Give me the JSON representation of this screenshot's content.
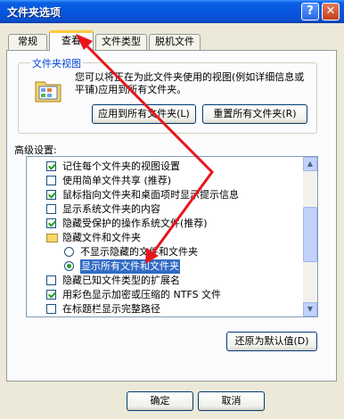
{
  "title": "文件夹选项",
  "title_buttons": {
    "help": "?",
    "close": "✕"
  },
  "tabs": [
    {
      "label": "常规"
    },
    {
      "label": "查看"
    },
    {
      "label": "文件类型"
    },
    {
      "label": "脱机文件"
    }
  ],
  "folder_views": {
    "label": "文件夹视图",
    "description": "您可以将正在为此文件夹使用的视图(例如详细信息或平铺)应用到所有文件夹。",
    "apply_all_button": "应用到所有文件夹(L)",
    "reset_all_button": "重置所有文件夹(R)"
  },
  "advanced": {
    "label": "高级设置:",
    "items": [
      {
        "type": "checkbox",
        "checked": true,
        "label": "记住每个文件夹的视图设置"
      },
      {
        "type": "checkbox",
        "checked": false,
        "label": "使用简单文件共享 (推荐)"
      },
      {
        "type": "checkbox",
        "checked": true,
        "label": "鼠标指向文件夹和桌面项时显示提示信息"
      },
      {
        "type": "checkbox",
        "checked": false,
        "label": "显示系统文件夹的内容"
      },
      {
        "type": "checkbox",
        "checked": true,
        "label": "隐藏受保护的操作系统文件(推荐)"
      },
      {
        "type": "folder",
        "label": "隐藏文件和文件夹"
      },
      {
        "type": "radio",
        "checked": false,
        "label": "不显示隐藏的文件和文件夹"
      },
      {
        "type": "radio",
        "checked": true,
        "label": "显示所有文件和文件夹"
      },
      {
        "type": "checkbox",
        "checked": false,
        "label": "隐藏已知文件类型的扩展名"
      },
      {
        "type": "checkbox",
        "checked": true,
        "label": "用彩色显示加密或压缩的 NTFS 文件"
      },
      {
        "type": "checkbox",
        "checked": false,
        "label": "在标题栏显示完整路径"
      }
    ],
    "restore_button": "还原为默认值(D)"
  },
  "footer": {
    "ok": "确定",
    "cancel": "取消"
  },
  "colors": {
    "titlebar": "#0656dd",
    "selection": "#316ac5",
    "arrow": "#e8151b"
  },
  "icons": {
    "scroll_up": "▲",
    "scroll_down": "▼"
  }
}
